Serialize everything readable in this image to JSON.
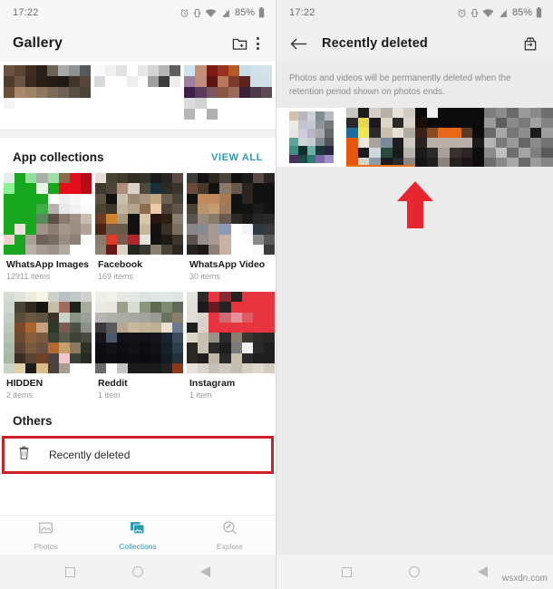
{
  "theme": {
    "accent": "#2c9ab0",
    "highlight": "#cc2026",
    "arrow": "#e8262f",
    "underline": "#e8711a"
  },
  "left": {
    "status": {
      "time": "17:22",
      "battery": "85%",
      "icons": [
        "alarm-icon",
        "vibrate-icon",
        "wifi-icon",
        "signal-icon",
        "battery-icon"
      ]
    },
    "appbar": {
      "title": "Gallery",
      "new_folder_icon": "new-folder-icon",
      "overflow_icon": "overflow-menu-icon"
    },
    "sections": {
      "app_collections": {
        "title": "App collections",
        "view_all": "VIEW ALL"
      },
      "others": {
        "title": "Others"
      }
    },
    "collections": [
      {
        "name": "WhatsApp Images",
        "count": "12911 items"
      },
      {
        "name": "Facebook",
        "count": "169 items"
      },
      {
        "name": "WhatsApp Video",
        "count": "30 items"
      },
      {
        "name": "HIDDEN",
        "count": "2 items"
      },
      {
        "name": "Reddit",
        "count": "1 item"
      },
      {
        "name": "Instagram",
        "count": "1 item"
      }
    ],
    "recently_deleted": {
      "label": "Recently deleted",
      "icon": "trash-icon"
    },
    "bottom_nav": [
      {
        "label": "Photos",
        "icon": "photo-icon",
        "active": false
      },
      {
        "label": "Collections",
        "icon": "collections-icon",
        "active": true
      },
      {
        "label": "Explore",
        "icon": "explore-icon",
        "active": false
      }
    ]
  },
  "right": {
    "status": {
      "time": "17:22",
      "battery": "85%"
    },
    "appbar": {
      "title": "Recently deleted",
      "back_icon": "back-arrow-icon",
      "action_icon": "empty-trash-icon"
    },
    "notice": "Photos and videos will be permanently deleted when the retention period shown on photos ends.",
    "annotation": {
      "icon": "red-up-arrow-annotation"
    }
  },
  "system_nav": {
    "recents_icon": "recents-square-icon",
    "home_icon": "home-circle-icon",
    "back_icon": "back-triangle-icon"
  },
  "watermark": "wsxdn.com"
}
